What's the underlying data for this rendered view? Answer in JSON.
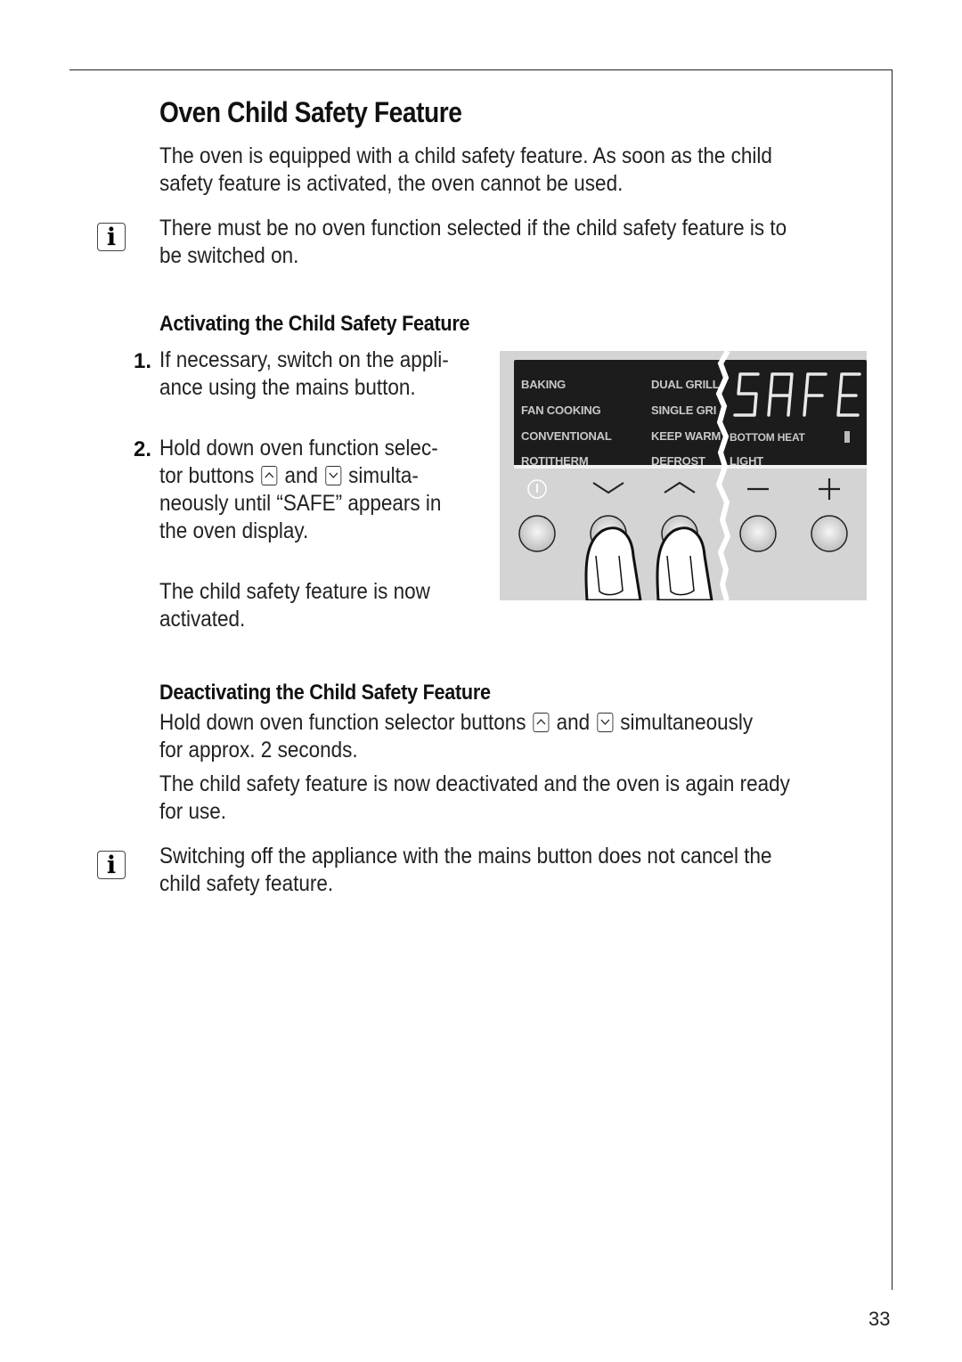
{
  "page": {
    "title": "Oven Child Safety Feature",
    "intro": [
      "The oven is equipped with a child safety feature. As soon as the child",
      "safety feature is activated, the oven cannot be used."
    ],
    "info_note_1": [
      "There must be no oven function selected if the child safety feature is to",
      "be switched on."
    ],
    "page_number": "33"
  },
  "activating": {
    "heading": "Activating the Child Safety Feature",
    "steps": [
      {
        "number": "1.",
        "lines": [
          "If necessary, switch on the appli-",
          "ance using the mains button."
        ]
      },
      {
        "number": "2.",
        "line1": "Hold down oven function selec-",
        "line2_a": "tor buttons",
        "line2_b": "and",
        "line2_c": "simulta-",
        "line3": "neously until “SAFE” appears in",
        "line4": "the oven display."
      }
    ],
    "result": [
      "The child safety feature is now",
      "activated."
    ]
  },
  "illustration": {
    "display_text": "SAFE",
    "labels_col1": [
      "BAKING",
      "FAN COOKING",
      "CONVENTIONAL",
      "ROTITHERM"
    ],
    "labels_col2": [
      "DUAL GRILL",
      "SINGLE GRI",
      "KEEP WARM",
      "DEFROST"
    ],
    "labels_col3": [
      "BOTTOM HEAT",
      "LIGHT"
    ],
    "buttons": [
      "power-icon",
      "chevron-down-icon",
      "chevron-up-icon",
      "minus-icon",
      "plus-icon"
    ]
  },
  "deactivating": {
    "heading": "Deactivating the Child Safety Feature",
    "line1_a": "Hold down oven function selector buttons",
    "line1_b": "and",
    "line1_c": "simultaneously",
    "line2": "for approx. 2 seconds.",
    "result": [
      "The child safety feature is now deactivated and the oven is again ready",
      "for use."
    ]
  },
  "info_note_2": [
    "Switching off the appliance with the mains button does not cancel the",
    "child safety feature."
  ]
}
